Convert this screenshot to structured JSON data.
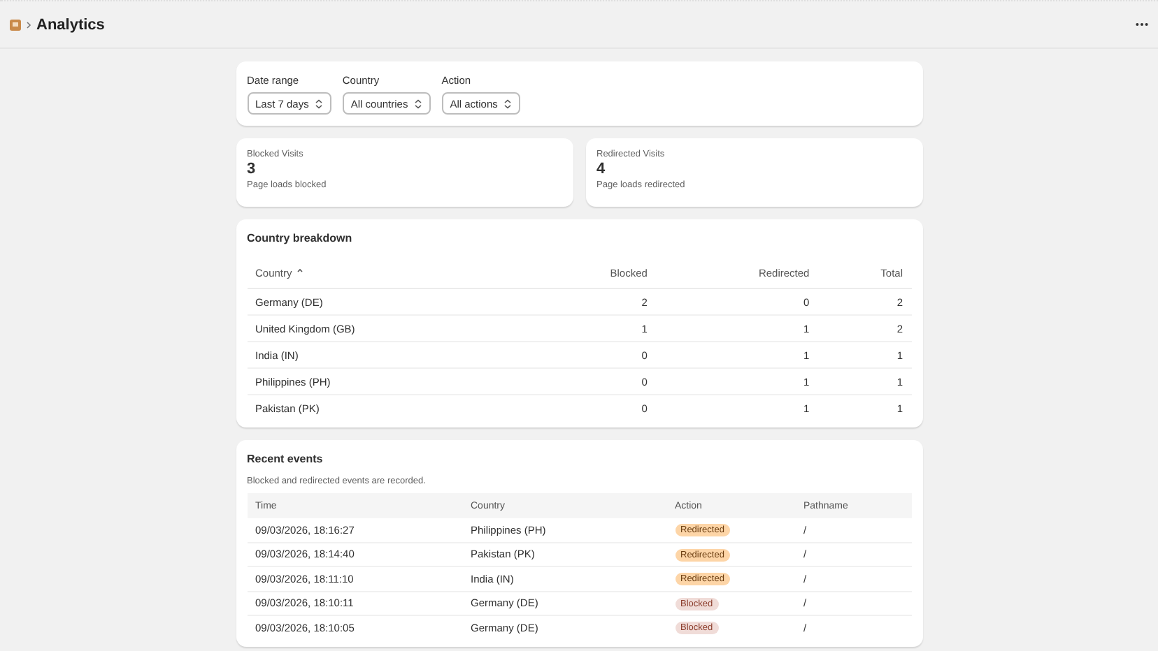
{
  "header": {
    "title": "Analytics"
  },
  "filters": [
    {
      "label": "Date range",
      "value": "Last 7 days"
    },
    {
      "label": "Country",
      "value": "All countries"
    },
    {
      "label": "Action",
      "value": "All actions"
    }
  ],
  "stats": [
    {
      "title": "Blocked Visits",
      "value": "3",
      "caption": "Page loads blocked"
    },
    {
      "title": "Redirected Visits",
      "value": "4",
      "caption": "Page loads redirected"
    }
  ],
  "country_breakdown": {
    "title": "Country breakdown",
    "columns": [
      "Country",
      "Blocked",
      "Redirected",
      "Total"
    ],
    "rows": [
      [
        "Germany (DE)",
        "2",
        "0",
        "2"
      ],
      [
        "United Kingdom (GB)",
        "1",
        "1",
        "2"
      ],
      [
        "India (IN)",
        "0",
        "1",
        "1"
      ],
      [
        "Philippines (PH)",
        "0",
        "1",
        "1"
      ],
      [
        "Pakistan (PK)",
        "0",
        "1",
        "1"
      ]
    ]
  },
  "recent_events": {
    "title": "Recent events",
    "description": "Blocked and redirected events are recorded.",
    "columns": [
      "Time",
      "Country",
      "Action",
      "Pathname"
    ],
    "rows": [
      {
        "time": "09/03/2026, 18:16:27",
        "country": "Philippines (PH)",
        "action": "Redirected",
        "kind": "redirected",
        "pathname": "/"
      },
      {
        "time": "09/03/2026, 18:14:40",
        "country": "Pakistan (PK)",
        "action": "Redirected",
        "kind": "redirected",
        "pathname": "/"
      },
      {
        "time": "09/03/2026, 18:11:10",
        "country": "India (IN)",
        "action": "Redirected",
        "kind": "redirected",
        "pathname": "/"
      },
      {
        "time": "09/03/2026, 18:10:11",
        "country": "Germany (DE)",
        "action": "Blocked",
        "kind": "blocked",
        "pathname": "/"
      },
      {
        "time": "09/03/2026, 18:10:05",
        "country": "Germany (DE)",
        "action": "Blocked",
        "kind": "blocked",
        "pathname": "/"
      }
    ]
  }
}
